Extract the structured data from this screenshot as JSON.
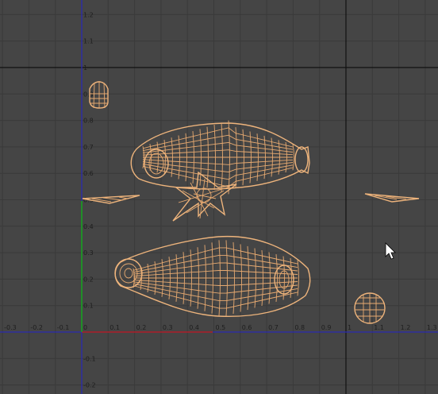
{
  "viewport": {
    "name": "UV Editor viewport",
    "colors": {
      "background": "#454545",
      "grid": "#3a3a3a",
      "uv_boundary": "#111111",
      "axis_u": "#2a2ab0",
      "axis_v_positive": "#1aa31a",
      "axis_u_positive": "#b02020",
      "wireframe": "#e6a970"
    }
  },
  "x_tick_labels": [
    "-0.3",
    "-0.2",
    "-0.1",
    "0",
    "0.1",
    "0.2",
    "0.3",
    "0.4",
    "0.5",
    "0.6",
    "0.7",
    "0.8",
    "0.9",
    "1",
    "1.1",
    "1.2",
    "1.3"
  ],
  "y_tick_labels": [
    "1.2",
    "1.1",
    "1",
    "0.9",
    "0.8",
    "0.7",
    "0.6",
    "0.5",
    "0.4",
    "0.3",
    "0.2",
    "0.1",
    "-0.1",
    "-0.2"
  ],
  "uv_shells": [
    {
      "name": "upper-fish-body-shell"
    },
    {
      "name": "lower-fish-body-shell"
    },
    {
      "name": "small-cap-shell"
    },
    {
      "name": "round-cap-shell"
    },
    {
      "name": "left-fin-shell"
    },
    {
      "name": "right-fin-shell"
    },
    {
      "name": "tail-star-shell"
    }
  ],
  "cursor": {
    "icon": "arrow-cursor-icon"
  }
}
